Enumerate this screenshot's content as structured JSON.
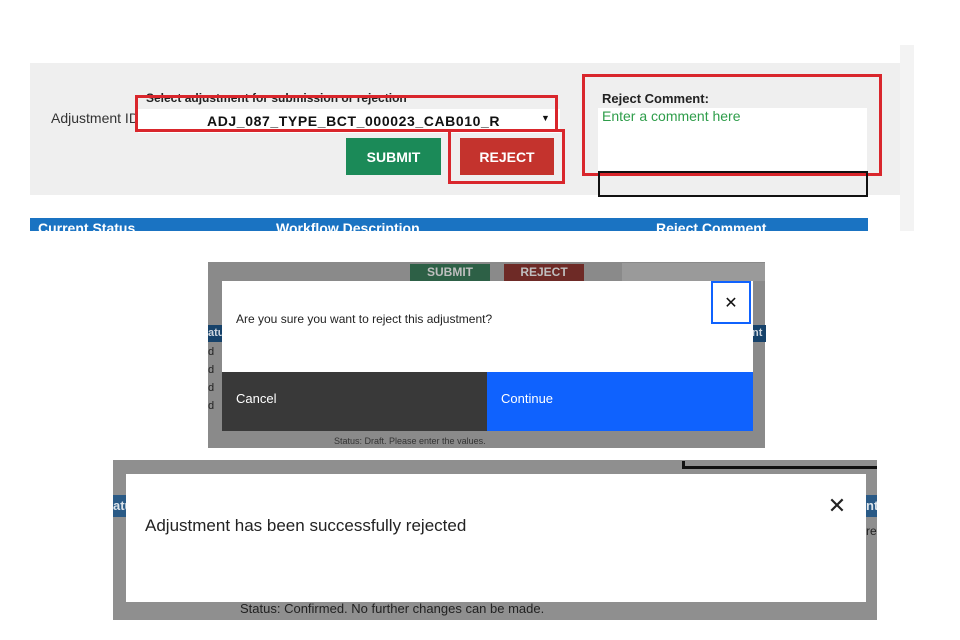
{
  "adjustment_form": {
    "adjustment_id_label": "Adjustment ID",
    "select_hint": "Select adjustment for submission or rejection",
    "selected_adjustment": "ADJ_087_TYPE_BCT_000023_CAB010_R",
    "submit_label": "SUBMIT",
    "reject_label": "REJECT",
    "reject_comment_label": "Reject Comment:",
    "reject_comment_placeholder": "Enter a comment here",
    "highlight_color": "#d9262c",
    "table_headers": [
      "Current Status",
      "Workflow Description",
      "Reject Comment"
    ]
  },
  "confirm_dialog": {
    "background_submit": "SUBMIT",
    "background_reject": "REJECT",
    "background_header_left": "atu",
    "background_header_right": "nt",
    "background_rows": [
      "d",
      "d",
      "d",
      "d"
    ],
    "message": "Are you sure you want to reject this adjustment?",
    "close_glyph": "✕",
    "cancel_label": "Cancel",
    "continue_label": "Continue",
    "status_text": "Status: Draft. Please enter the values."
  },
  "success_toast": {
    "background_header_left": "atu",
    "background_header_right": "nt",
    "background_fragment": "re",
    "message": "Adjustment has been successfully rejected",
    "close_glyph": "✕",
    "status_text": "Status: Confirmed. No further changes can be made."
  }
}
